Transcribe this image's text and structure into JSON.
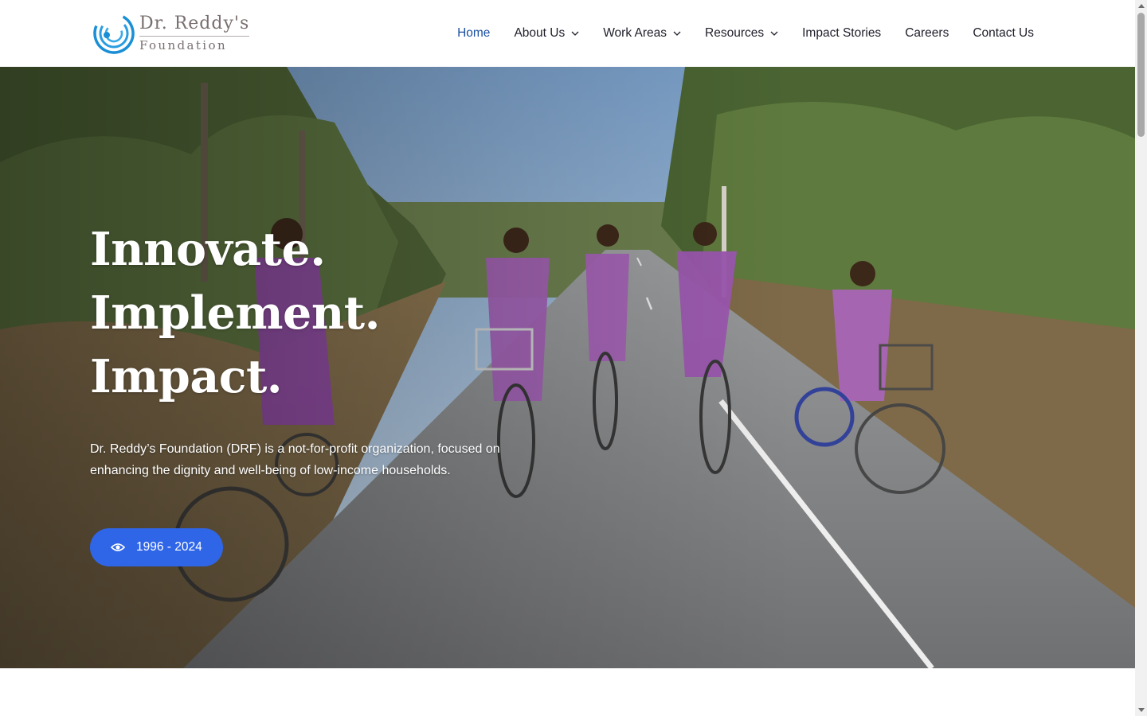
{
  "header": {
    "logo": {
      "line1": "Dr. Reddy's",
      "line2": "Foundation"
    },
    "nav": [
      {
        "label": "Home",
        "active": true,
        "dropdown": false
      },
      {
        "label": "About Us",
        "active": false,
        "dropdown": true
      },
      {
        "label": "Work Areas",
        "active": false,
        "dropdown": true
      },
      {
        "label": "Resources",
        "active": false,
        "dropdown": true
      },
      {
        "label": "Impact Stories",
        "active": false,
        "dropdown": false
      },
      {
        "label": "Careers",
        "active": false,
        "dropdown": false
      },
      {
        "label": "Contact Us",
        "active": false,
        "dropdown": false
      }
    ]
  },
  "hero": {
    "title_lines": [
      "Innovate.",
      "Implement.",
      "Impact."
    ],
    "description": "Dr. Reddy’s Foundation (DRF) is a not-for-profit organization, focused on enhancing the dignity and well-being of low-income households.",
    "button": {
      "label": "1996 - 2024",
      "icon": "eye-icon"
    }
  },
  "colors": {
    "nav_active": "#1b4fa0",
    "nav_text": "#1e1e2a",
    "button_bg": "#2f66e8",
    "logo_text": "#7a6f6f",
    "logo_mark": "#1a8fd6"
  }
}
